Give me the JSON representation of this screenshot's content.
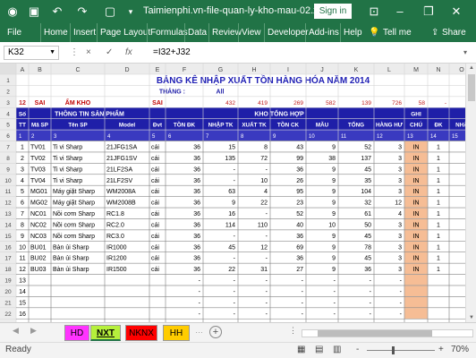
{
  "window": {
    "title": "Taimienphi.vn-file-quan-ly-kho-mau-02.xls...",
    "sign_in": "Sign in"
  },
  "ribbon": {
    "tabs": [
      "File",
      "Home",
      "Insert",
      "Page Layout",
      "Formulas",
      "Data",
      "Review",
      "View",
      "Developer",
      "Add-ins",
      "Help"
    ],
    "tell_me": "Tell me",
    "share": "Share"
  },
  "formula_bar": {
    "name_box": "K32",
    "cancel": "×",
    "enter": "✓",
    "fx": "fx",
    "formula": "=I32+J32"
  },
  "columns": [
    "A",
    "B",
    "C",
    "D",
    "E",
    "F",
    "G",
    "H",
    "I",
    "J",
    "K",
    "L",
    "M",
    "N",
    "O"
  ],
  "sheet": {
    "title": "BẢNG KÊ NHẬP XUẤT TỒN HÀNG HÓA NĂM 2014",
    "thang_label": "THÁNG :",
    "thang_value": "All",
    "row3": [
      "12",
      "SAI",
      "ẨM KHO",
      "",
      "SAI",
      "",
      "432",
      "419",
      "269",
      "582",
      "139",
      "726",
      "58",
      "-",
      "12"
    ],
    "group_info": "THÔNG TIN SẢN PHẨM",
    "group_store": "KHO TỔNG HỢP",
    "so_tt": [
      "Số",
      "TT"
    ],
    "ghi_chu": [
      "GHI",
      "CHÚ"
    ],
    "headers": [
      "Mã SP",
      "Tên SP",
      "Model",
      "Đvt",
      "TỒN ĐK",
      "NHẬP TK",
      "XUẤT TK",
      "TỒN CK",
      "MẪU",
      "TỔNG",
      "HÀNG HƯ",
      "ĐK",
      "NHẬ"
    ],
    "index_row": [
      "1",
      "2",
      "3",
      "4",
      "5",
      "6",
      "7",
      "8",
      "9",
      "10",
      "11",
      "12",
      "13",
      "14",
      "15"
    ],
    "rows": [
      [
        "1",
        "TV01",
        "Ti vi Sharp",
        "21JFG1SA",
        "cái",
        "36",
        "15",
        "8",
        "43",
        "9",
        "52",
        "3",
        "IN",
        "1",
        ""
      ],
      [
        "2",
        "TV02",
        "Ti vi Sharp",
        "21JFG1SV",
        "cái",
        "36",
        "135",
        "72",
        "99",
        "38",
        "137",
        "3",
        "IN",
        "1",
        ""
      ],
      [
        "3",
        "TV03",
        "Ti vi Sharp",
        "21LF2SA",
        "cái",
        "36",
        "-",
        "-",
        "36",
        "9",
        "45",
        "3",
        "IN",
        "1",
        ""
      ],
      [
        "4",
        "TV04",
        "Ti vi Sharp",
        "21LF2SV",
        "cái",
        "36",
        "-",
        "10",
        "26",
        "9",
        "35",
        "3",
        "IN",
        "1",
        ""
      ],
      [
        "5",
        "MG01",
        "Máy giặt Sharp",
        "WM2008A",
        "cái",
        "36",
        "63",
        "4",
        "95",
        "9",
        "104",
        "3",
        "IN",
        "1",
        ""
      ],
      [
        "6",
        "MG02",
        "Máy giặt Sharp",
        "WM2008B",
        "cái",
        "36",
        "9",
        "22",
        "23",
        "9",
        "32",
        "12",
        "IN",
        "1",
        ""
      ],
      [
        "7",
        "NC01",
        "Nồi cơm Sharp",
        "RC1.8",
        "cái",
        "36",
        "16",
        "-",
        "52",
        "9",
        "61",
        "4",
        "IN",
        "1",
        ""
      ],
      [
        "8",
        "NC02",
        "Nồi cơm Sharp",
        "RC2.0",
        "cái",
        "36",
        "114",
        "110",
        "40",
        "10",
        "50",
        "3",
        "IN",
        "1",
        ""
      ],
      [
        "9",
        "NC03",
        "Nồi cơm Sharp",
        "RC3.0",
        "cái",
        "36",
        "-",
        "-",
        "36",
        "9",
        "45",
        "3",
        "IN",
        "1",
        ""
      ],
      [
        "10",
        "BU01",
        "Bàn ủi Sharp",
        "IR1000",
        "cái",
        "36",
        "45",
        "12",
        "69",
        "9",
        "78",
        "3",
        "IN",
        "1",
        ""
      ],
      [
        "11",
        "BU02",
        "Bàn ủi Sharp",
        "IR1200",
        "cái",
        "36",
        "-",
        "-",
        "36",
        "9",
        "45",
        "3",
        "IN",
        "1",
        ""
      ],
      [
        "12",
        "BU03",
        "Bàn ủi Sharp",
        "IR1500",
        "cái",
        "36",
        "22",
        "31",
        "27",
        "9",
        "36",
        "3",
        "IN",
        "1",
        ""
      ],
      [
        "13",
        "",
        "",
        "",
        "",
        "-",
        "-",
        "-",
        "-",
        "-",
        "-",
        "-",
        "",
        "",
        ""
      ],
      [
        "14",
        "",
        "",
        "",
        "",
        "-",
        "-",
        "-",
        "-",
        "-",
        "-",
        "-",
        "",
        "",
        ""
      ],
      [
        "15",
        "",
        "",
        "",
        "",
        "-",
        "-",
        "-",
        "-",
        "-",
        "-",
        "-",
        "",
        "",
        ""
      ],
      [
        "16",
        "",
        "",
        "",
        "",
        "-",
        "-",
        "-",
        "-",
        "-",
        "-",
        "-",
        "",
        "",
        ""
      ]
    ],
    "row_numbers": [
      "1",
      "2",
      "3",
      "4",
      "5",
      "6",
      "7",
      "8",
      "9",
      "10",
      "11",
      "12",
      "13",
      "14",
      "15",
      "16",
      "17",
      "18",
      "19",
      "20",
      "21",
      "22"
    ]
  },
  "sheet_tabs": [
    {
      "label": "HD",
      "color": "#ff33ff"
    },
    {
      "label": "NXT",
      "color": "#b6f03c"
    },
    {
      "label": "NKNX",
      "color": "#ff0000"
    },
    {
      "label": "HH",
      "color": "#ffcc00"
    }
  ],
  "status": {
    "ready": "Ready",
    "zoom": "70%",
    "minus": "-",
    "plus": "+"
  },
  "colors": {
    "accent": "#217346",
    "title_blue": "#1f1fb4",
    "header_blue": "#1f1fa8",
    "note_orange": "#f4b183",
    "red_text": "#c00000"
  }
}
